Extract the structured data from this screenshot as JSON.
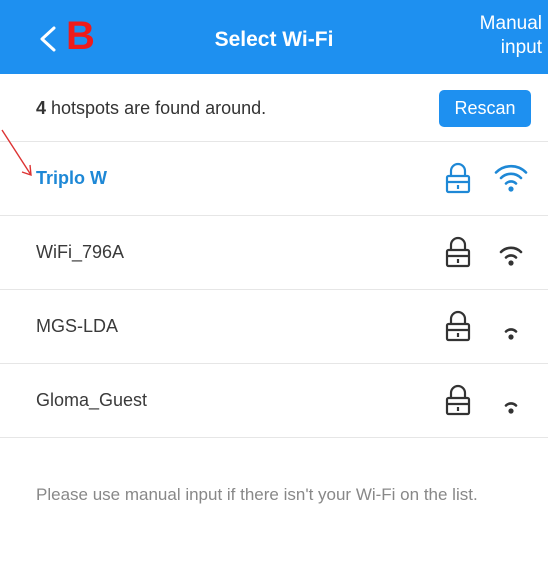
{
  "header": {
    "brand_letter": "B",
    "title": "Select Wi-Fi",
    "manual_line1": "Manual",
    "manual_line2": "input",
    "color": "#1e90f0"
  },
  "summary": {
    "count": "4",
    "text": " hotspots are found around.",
    "rescan_label": "Rescan"
  },
  "networks": [
    {
      "name": "Triplo W",
      "selected": true,
      "signal_level": 4
    },
    {
      "name": "WiFi_796A",
      "selected": false,
      "signal_level": 3
    },
    {
      "name": "MGS-LDA",
      "selected": false,
      "signal_level": 2
    },
    {
      "name": "Gloma_Guest",
      "selected": false,
      "signal_level": 2
    }
  ],
  "footer": {
    "note": "Please use manual input if there isn't your Wi-Fi on the list."
  },
  "colors": {
    "accent": "#1e90f0",
    "selected_text": "#1e88d6",
    "brand_red": "#ee1b1b",
    "annotation_arrow": "#d33"
  }
}
